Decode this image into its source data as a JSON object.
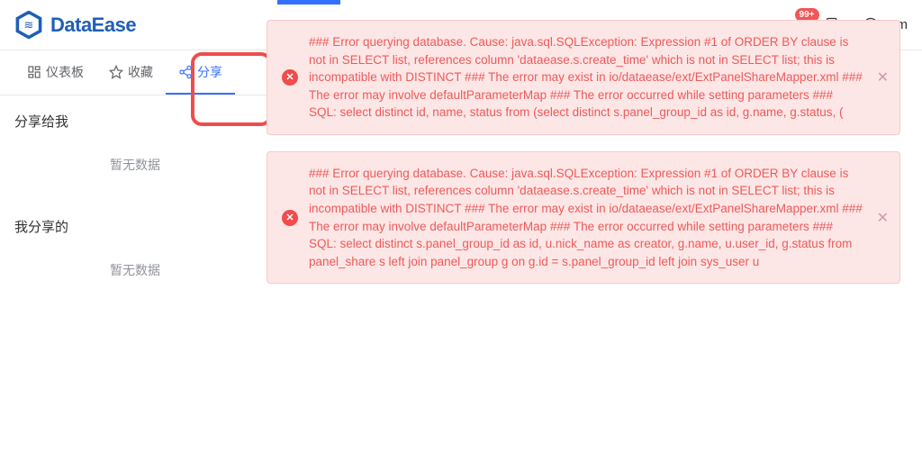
{
  "brand": "DataEase",
  "topbar": {
    "notification_badge": "99+",
    "user_initial": "m"
  },
  "tabs": [
    {
      "icon": "dashboard",
      "label": "仪表板"
    },
    {
      "icon": "star",
      "label": "收藏"
    },
    {
      "icon": "share",
      "label": "分享",
      "active": true
    }
  ],
  "sidebar": {
    "section1_title": "分享给我",
    "section1_empty": "暂无数据",
    "section2_title": "我分享的",
    "section2_empty": "暂无数据"
  },
  "toasts": [
    {
      "message": "### Error querying database. Cause: java.sql.SQLException: Expression #1 of ORDER BY clause is not in SELECT list, references column 'dataease.s.create_time' which is not in SELECT list; this is incompatible with DISTINCT ### The error may exist in io/dataease/ext/ExtPanelShareMapper.xml ### The error may involve defaultParameterMap ### The error occurred while setting parameters ### SQL: select distinct id, name, status from (select distinct s.panel_group_id as id, g.name, g.status, ("
    },
    {
      "message": "### Error querying database. Cause: java.sql.SQLException: Expression #1 of ORDER BY clause is not in SELECT list, references column 'dataease.s.create_time' which is not in SELECT list; this is incompatible with DISTINCT ### The error may exist in io/dataease/ext/ExtPanelShareMapper.xml ### The error may involve defaultParameterMap ### The error occurred while setting parameters ### SQL: select distinct s.panel_group_id as id, u.nick_name as creator, g.name, u.user_id, g.status from panel_share s left join panel_group g on g.id = s.panel_group_id left join sys_user u"
    }
  ]
}
